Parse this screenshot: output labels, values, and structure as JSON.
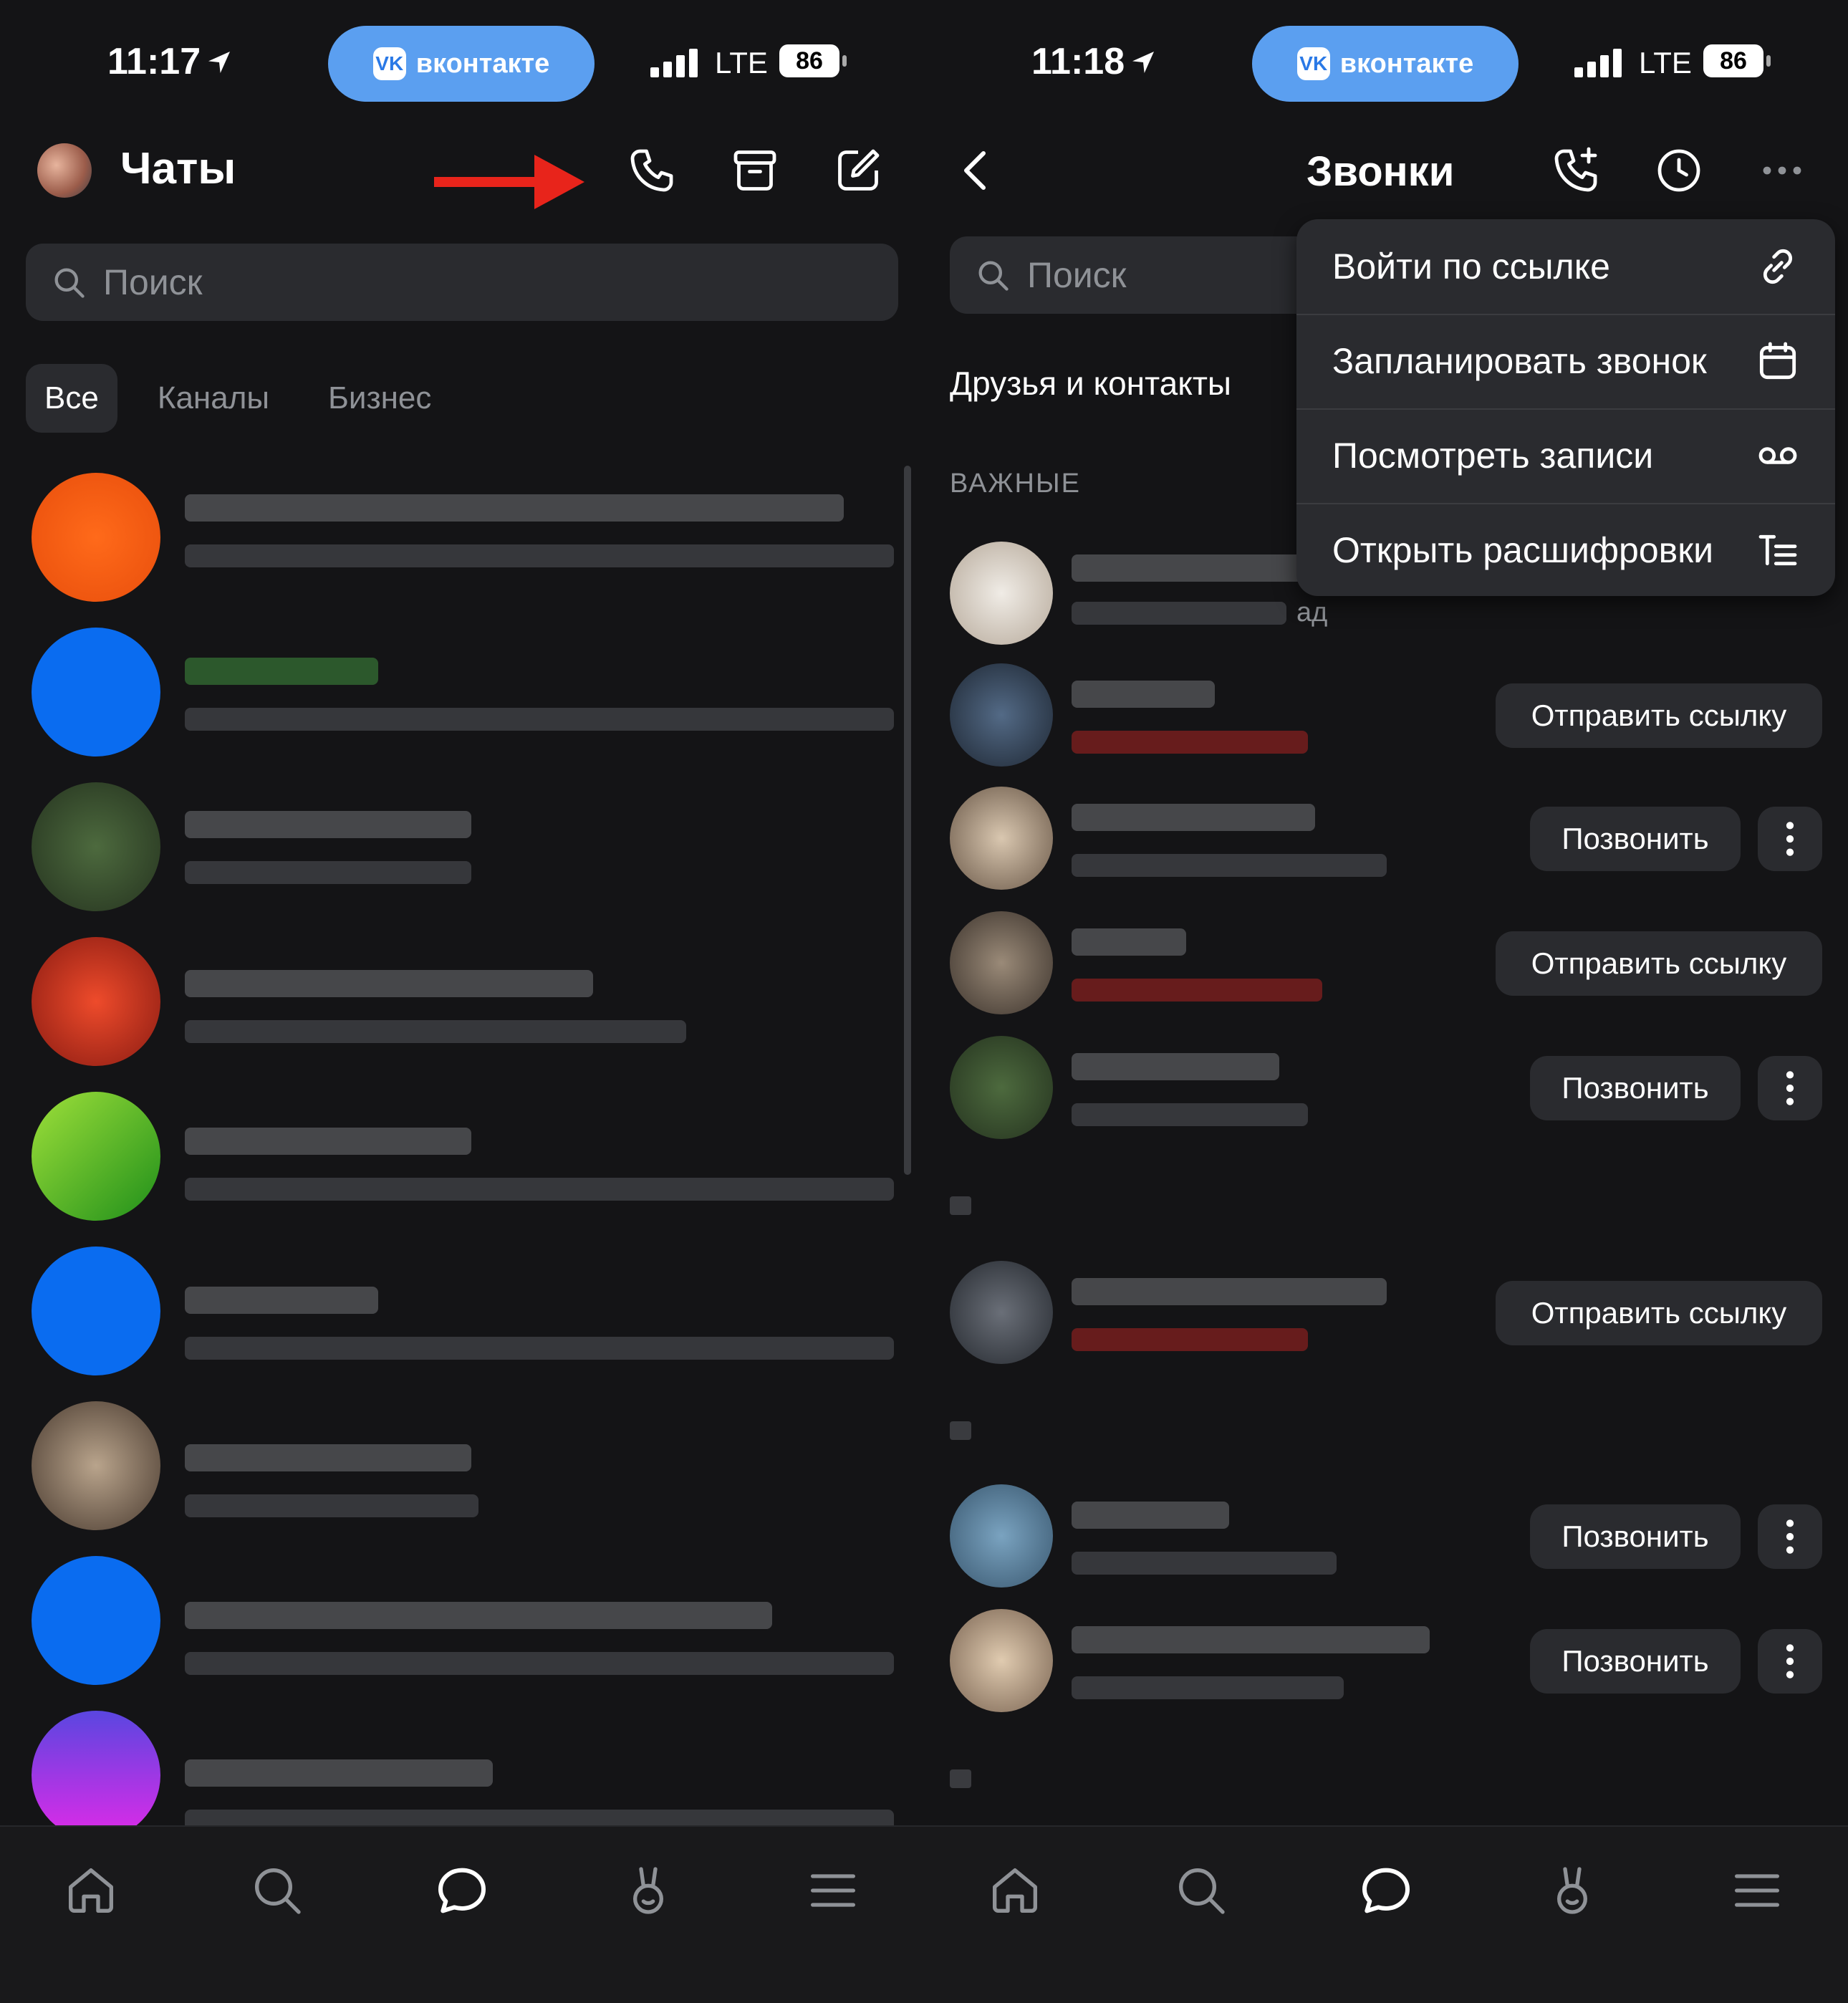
{
  "status_left": {
    "time": "11:17",
    "network": "LTE",
    "battery": "86"
  },
  "status_right": {
    "time": "11:18",
    "network": "LTE",
    "battery": "86"
  },
  "pill": {
    "label": "вконтакте",
    "logo": "VK"
  },
  "left": {
    "title": "Чаты",
    "search_placeholder": "Поиск",
    "tabs": [
      "Все",
      "Каналы",
      "Бизнес"
    ]
  },
  "right": {
    "title": "Звонки",
    "search_placeholder": "Поиск",
    "contacts_label": "Друзья и контакты",
    "section_label": "ВАЖНЫЕ",
    "partial_text": "ад",
    "buttons": {
      "send_link": "Отправить ссылку",
      "call": "Позвонить"
    },
    "menu": [
      {
        "label": "Войти по ссылке",
        "icon": "link-icon"
      },
      {
        "label": "Запланировать звонок",
        "icon": "calendar-icon"
      },
      {
        "label": "Посмотреть записи",
        "icon": "recordings-icon"
      },
      {
        "label": "Открыть расшифровки",
        "icon": "transcript-icon"
      }
    ]
  },
  "colors": {
    "background": "#141416",
    "surface": "#2a2b2f",
    "accent_blue": "#5b9ff0",
    "vk_blue": "#0077ff",
    "arrow_red": "#e8241b"
  }
}
